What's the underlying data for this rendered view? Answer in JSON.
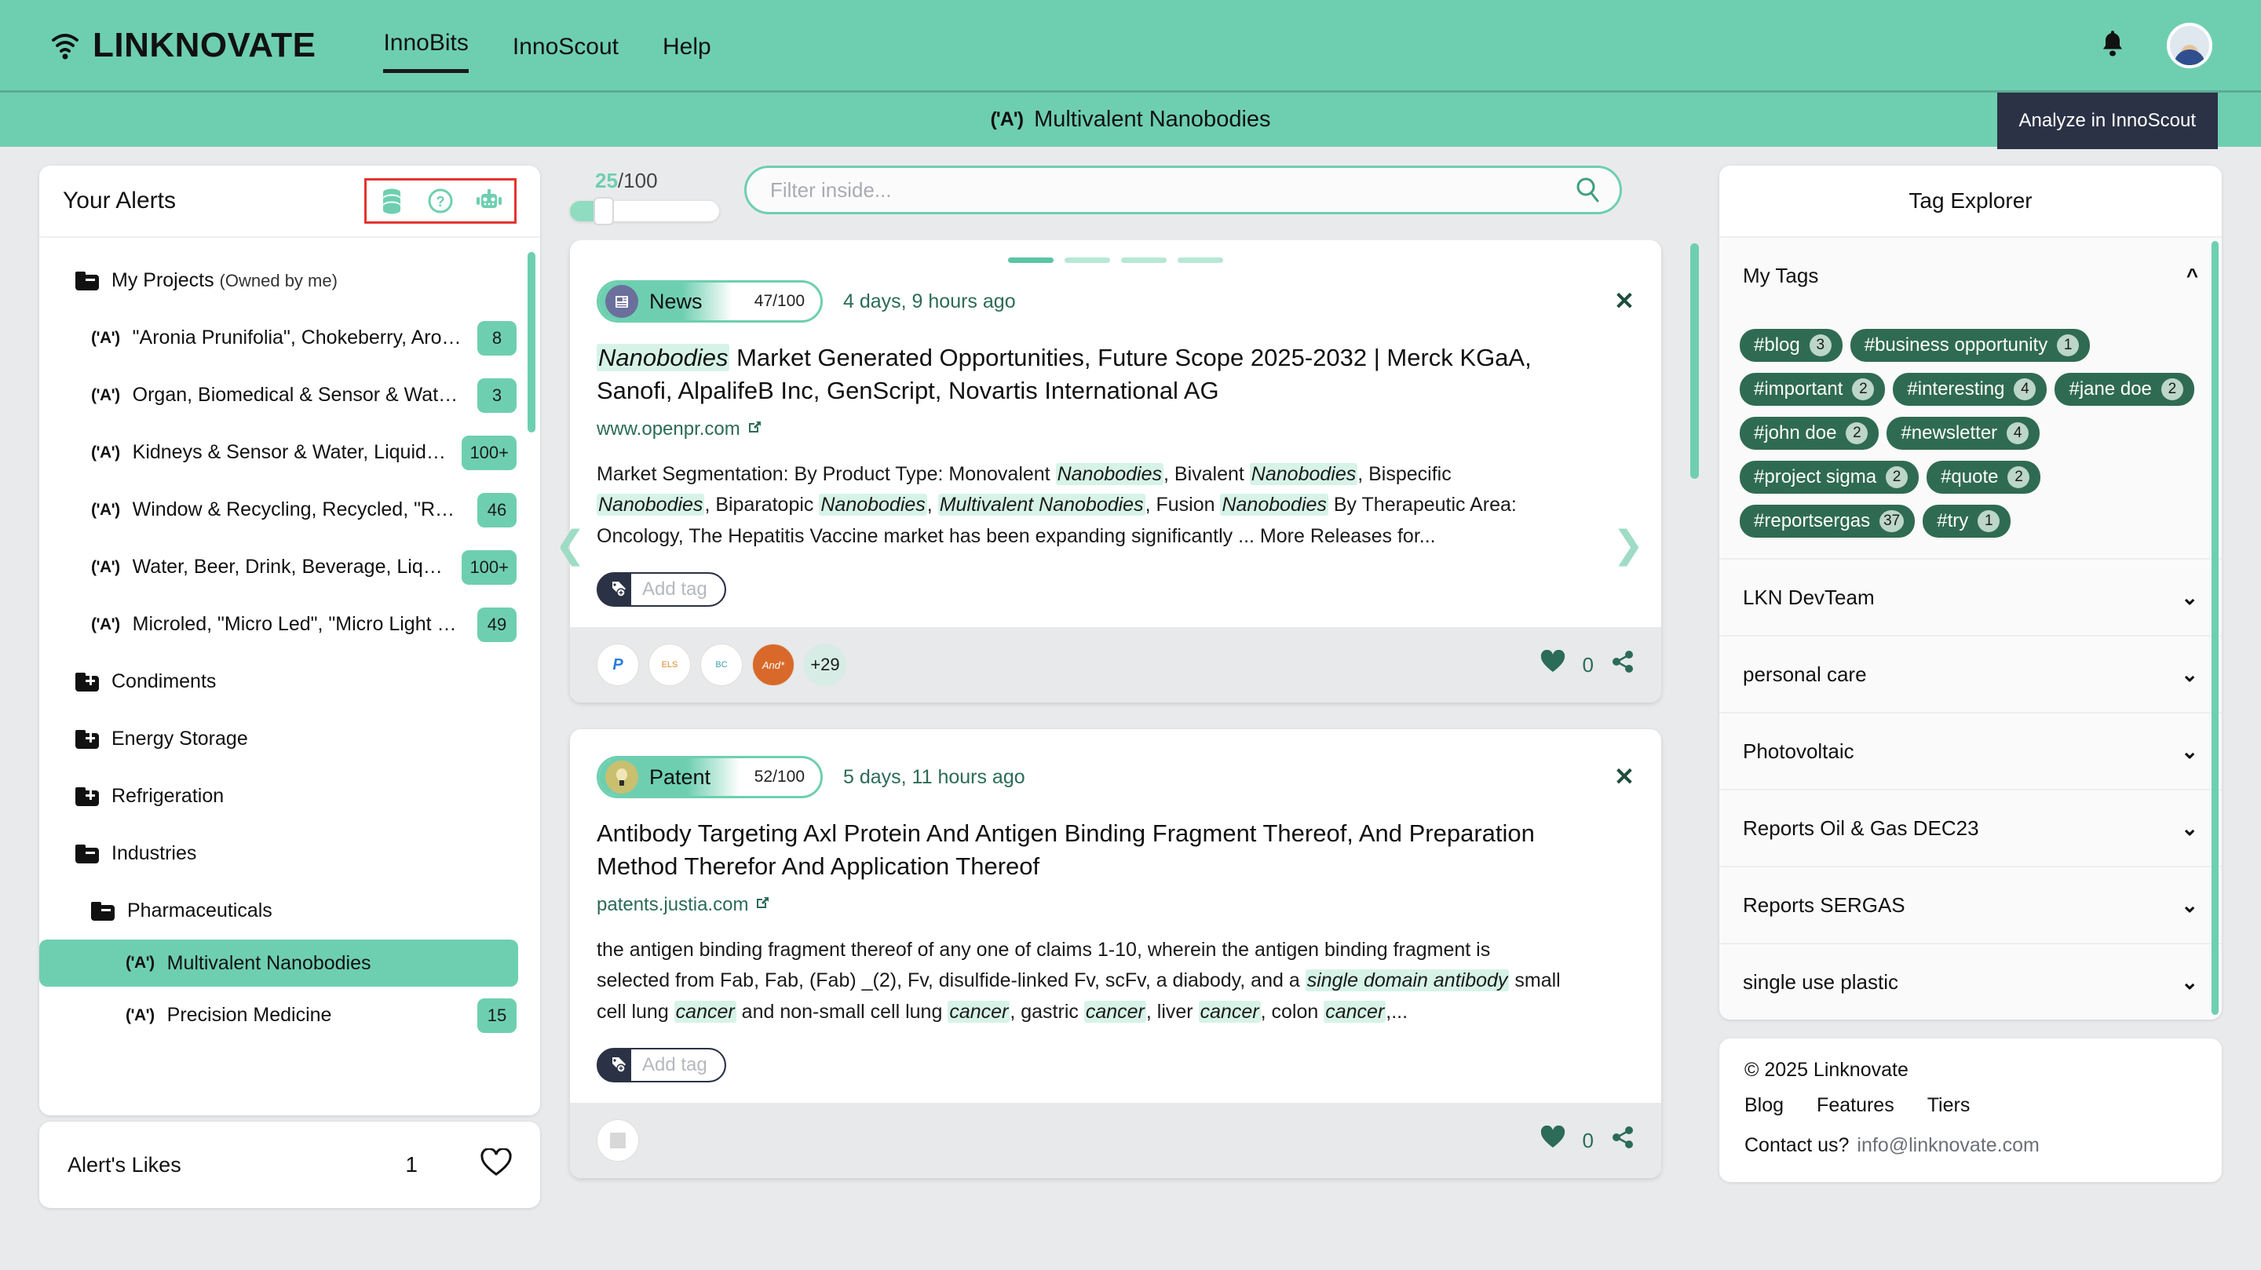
{
  "header": {
    "brand": "LINKNOVATE",
    "nav": [
      {
        "label": "InnoBits",
        "active": true
      },
      {
        "label": "InnoScout",
        "active": false
      },
      {
        "label": "Help",
        "active": false
      }
    ],
    "bell_icon": "bell-icon",
    "avatar_icon": "user-avatar"
  },
  "subheader": {
    "alert_glyph": "('A')",
    "title": "Multivalent Nanobodies",
    "analyze_button": "Analyze in InnoScout"
  },
  "sidebar": {
    "title": "Your Alerts",
    "head_icons": [
      "database-icon",
      "question-circle-icon",
      "robot-icon"
    ],
    "tree": [
      {
        "level": 1,
        "icon": "folder-minus-icon",
        "label": "My Projects",
        "suffix": "(Owned by me)",
        "badge": "",
        "selected": false
      },
      {
        "level": 2,
        "icon": "alert-icon",
        "label": "\"Aronia Prunifolia\", Chokeberry, Aron...",
        "badge": "8",
        "selected": false
      },
      {
        "level": 2,
        "icon": "alert-icon",
        "label": "Organ, Biomedical & Sensor & Water,...",
        "badge": "3",
        "selected": false
      },
      {
        "level": 2,
        "icon": "alert-icon",
        "label": "Kidneys & Sensor & Water, Liquid & P...",
        "badge": "100+",
        "selected": false
      },
      {
        "level": 2,
        "icon": "alert-icon",
        "label": "Window & Recycling, Recycled, \"Re ...",
        "badge": "46",
        "selected": false
      },
      {
        "level": 2,
        "icon": "alert-icon",
        "label": "Water, Beer, Drink, Beverage, Liquid, ...",
        "badge": "100+",
        "selected": false
      },
      {
        "level": 2,
        "icon": "alert-icon",
        "label": "Microled, \"Micro Led\", \"Micro Light E...",
        "badge": "49",
        "selected": false
      },
      {
        "level": 1,
        "icon": "folder-plus-icon",
        "label": "Condiments",
        "badge": "",
        "selected": false
      },
      {
        "level": 1,
        "icon": "folder-plus-icon",
        "label": "Energy Storage",
        "badge": "",
        "selected": false
      },
      {
        "level": 1,
        "icon": "folder-plus-icon",
        "label": "Refrigeration",
        "badge": "",
        "selected": false
      },
      {
        "level": 1,
        "icon": "folder-minus-icon",
        "label": "Industries",
        "badge": "",
        "selected": false
      },
      {
        "level": 2,
        "icon": "folder-minus-icon",
        "label": "Pharmaceuticals",
        "badge": "",
        "selected": false
      },
      {
        "level": 3,
        "icon": "alert-icon",
        "label": "Multivalent Nanobodies",
        "badge": "",
        "selected": true
      },
      {
        "level": 3,
        "icon": "alert-icon",
        "label": "Precision Medicine",
        "badge": "15",
        "selected": false
      }
    ],
    "likes_label": "Alert's Likes",
    "likes_count": "1",
    "likes_icon": "heart-outline-icon"
  },
  "center": {
    "score_slider": {
      "value": "25",
      "separator": "/",
      "max": "100"
    },
    "filter": {
      "placeholder": "Filter inside...",
      "value": "",
      "icon": "search-icon"
    },
    "pagination_dots": 4,
    "pagination_active_index": 0,
    "posts": [
      {
        "type": "News",
        "type_icon": "news-icon",
        "score": "47/100",
        "time": "4 days, 9 hours ago",
        "close_icon": "close-icon",
        "title_parts": [
          {
            "text": "Nanobodies",
            "highlight": true
          },
          {
            "text": " Market Generated Opportunities, Future Scope 2025-2032 | Merck KGaA, Sanofi, AlpalifeB Inc, GenScript, Novartis International AG",
            "highlight": false
          }
        ],
        "url": "www.openpr.com",
        "url_icon": "external-link-icon",
        "body_parts": [
          {
            "text": "Market Segmentation: By Product Type: Monovalent ",
            "highlight": false
          },
          {
            "text": "Nanobodies",
            "highlight": true
          },
          {
            "text": ", Bivalent ",
            "highlight": false
          },
          {
            "text": "Nanobodies",
            "highlight": true
          },
          {
            "text": ", Bispecific ",
            "highlight": false
          },
          {
            "text": "Nanobodies",
            "highlight": true
          },
          {
            "text": ", Biparatopic ",
            "highlight": false
          },
          {
            "text": "Nanobodies",
            "highlight": true
          },
          {
            "text": ", ",
            "highlight": false
          },
          {
            "text": "Multivalent Nanobodies",
            "highlight": true
          },
          {
            "text": ", Fusion ",
            "highlight": false
          },
          {
            "text": "Nanobodies",
            "highlight": true
          },
          {
            "text": " By Therapeutic Area: Oncology, The Hepatitis Vaccine market has been expanding significantly ... More Releases for...",
            "highlight": false
          }
        ],
        "tag_button": {
          "icon": "tag-plus-icon",
          "label": "Add tag"
        },
        "orgs": [
          {
            "name": "org-paypal",
            "text": "P",
            "style": "plain"
          },
          {
            "name": "org-elsevier",
            "text": "ELS",
            "style": "plain"
          },
          {
            "name": "org-biocentury",
            "text": "BC",
            "style": "plain"
          },
          {
            "name": "org-andi",
            "text": "And*",
            "style": "orange"
          }
        ],
        "orgs_more": "+29",
        "likes": "0",
        "heart_icon": "heart-solid-icon",
        "share_icon": "share-icon"
      },
      {
        "type": "Patent",
        "type_icon": "patent-bulb-icon",
        "score": "52/100",
        "time": "5 days, 11 hours ago",
        "close_icon": "close-icon",
        "title_parts": [
          {
            "text": "Antibody Targeting Axl Protein And Antigen Binding Fragment Thereof, And Preparation Method Therefor And Application Thereof",
            "highlight": false
          }
        ],
        "url": "patents.justia.com",
        "url_icon": "external-link-icon",
        "body_parts": [
          {
            "text": "the antigen binding fragment thereof of any one of claims 1-10, wherein the antigen binding fragment is selected from Fab, Fab, (Fab) _(2), Fv, disulfide-linked Fv, scFv, a diabody, and a ",
            "highlight": false
          },
          {
            "text": "single domain antibody",
            "highlight": true
          },
          {
            "text": " small cell lung ",
            "highlight": false
          },
          {
            "text": "cancer",
            "highlight": true
          },
          {
            "text": " and non-small cell lung ",
            "highlight": false
          },
          {
            "text": "cancer",
            "highlight": true
          },
          {
            "text": ", gastric ",
            "highlight": false
          },
          {
            "text": "cancer",
            "highlight": true
          },
          {
            "text": ", liver ",
            "highlight": false
          },
          {
            "text": "cancer",
            "highlight": true
          },
          {
            "text": ", colon ",
            "highlight": false
          },
          {
            "text": "cancer",
            "highlight": true
          },
          {
            "text": ",...",
            "highlight": false
          }
        ],
        "tag_button": {
          "icon": "tag-plus-icon",
          "label": "Add tag"
        },
        "orgs": [
          {
            "name": "org-unknown",
            "text": "",
            "style": "plain"
          }
        ],
        "orgs_more": "",
        "likes": "0",
        "heart_icon": "heart-solid-icon",
        "share_icon": "share-icon"
      }
    ],
    "prev_arrow": "chevron-left-icon",
    "next_arrow": "chevron-right-icon"
  },
  "tag_explorer": {
    "title": "Tag Explorer",
    "my_tags_label": "My Tags",
    "my_tags_expanded": true,
    "tags": [
      {
        "label": "#blog",
        "count": "3"
      },
      {
        "label": "#business opportunity",
        "count": "1"
      },
      {
        "label": "#important",
        "count": "2"
      },
      {
        "label": "#interesting",
        "count": "4"
      },
      {
        "label": "#jane doe",
        "count": "2"
      },
      {
        "label": "#john doe",
        "count": "2"
      },
      {
        "label": "#newsletter",
        "count": "4"
      },
      {
        "label": "#project sigma",
        "count": "2"
      },
      {
        "label": "#quote",
        "count": "2"
      },
      {
        "label": "#reportsergas",
        "count": "37"
      },
      {
        "label": "#try",
        "count": "1"
      }
    ],
    "sections": [
      {
        "label": "LKN DevTeam"
      },
      {
        "label": "personal care"
      },
      {
        "label": "Photovoltaic"
      },
      {
        "label": "Reports Oil & Gas DEC23"
      },
      {
        "label": "Reports SERGAS"
      },
      {
        "label": "single use plastic"
      }
    ]
  },
  "footer": {
    "copyright": "© 2025 Linknovate",
    "links": [
      "Blog",
      "Features",
      "Tiers"
    ],
    "contact_label": "Contact us?",
    "contact_email": "info@linknovate.com"
  },
  "colors": {
    "brand_green": "#6ecfb0",
    "dark_navy": "#2b3245",
    "tag_green": "#2f6b52",
    "highlight": "#d7f3e8",
    "page_bg": "#e9eaec"
  }
}
